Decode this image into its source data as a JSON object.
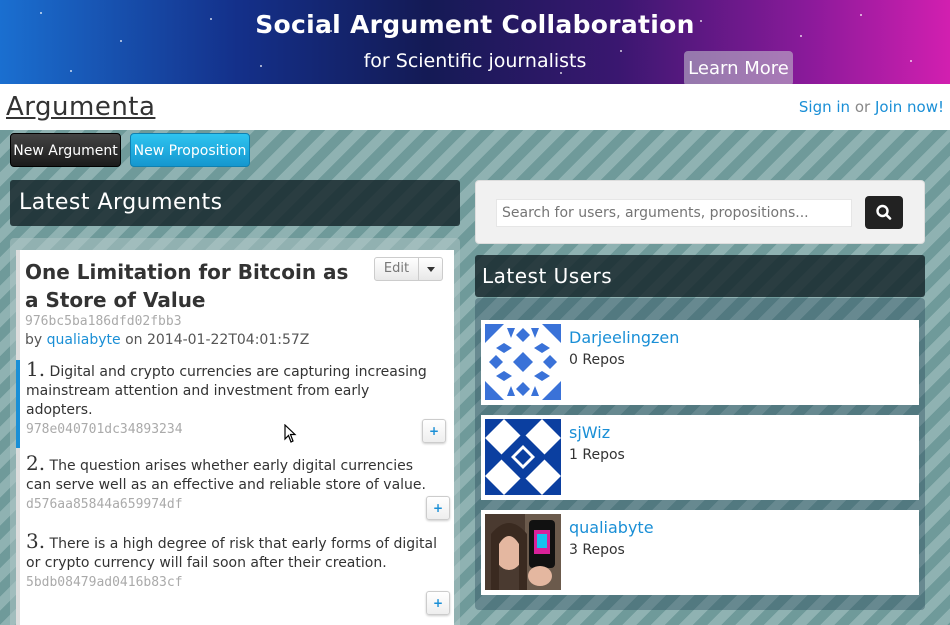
{
  "banner": {
    "title": "Social Argument Collaboration",
    "subtitle": "for Scientific journalists",
    "learn_more": "Learn More"
  },
  "nav": {
    "brand": "Argumenta",
    "sign_in": "Sign in",
    "or": "or",
    "join": "Join now!"
  },
  "toolbar": {
    "new_argument": "New Argument",
    "new_proposition": "New Proposition"
  },
  "latest_arguments": {
    "heading": "Latest Arguments",
    "argument": {
      "title": "One Limitation for Bitcoin as a Store of Value",
      "hash": "976bc5ba186dfd02fbb3",
      "by": "by",
      "author": "qualiabyte",
      "on": "on",
      "timestamp": "2014-01-22T04:01:57Z",
      "edit_label": "Edit",
      "propositions": [
        {
          "num": "1.",
          "text": "Digital and crypto currencies are capturing increasing mainstream attention and investment from early adopters.",
          "hash": "978e040701dc34893234"
        },
        {
          "num": "2.",
          "text": "The question arises whether early digital currencies can serve well as an effective and reliable store of value.",
          "hash": "d576aa85844a659974df"
        },
        {
          "num": "3.",
          "text": "There is a high degree of risk that early forms of digital or crypto currency will fail soon after their creation.",
          "hash": "5bdb08479ad0416b83cf"
        }
      ],
      "plus_label": "+"
    }
  },
  "search": {
    "placeholder": "Search for users, arguments, propositions..."
  },
  "latest_users": {
    "heading": "Latest Users",
    "users": [
      {
        "name": "Darjeelingzen",
        "repos": "0 Repos"
      },
      {
        "name": "sjWiz",
        "repos": "1 Repos"
      },
      {
        "name": "qualiabyte",
        "repos": "3 Repos"
      }
    ]
  },
  "colors": {
    "link": "#1a8fd6",
    "identicon_1": "#3a72d8",
    "identicon_2": "#0b3fa0"
  }
}
